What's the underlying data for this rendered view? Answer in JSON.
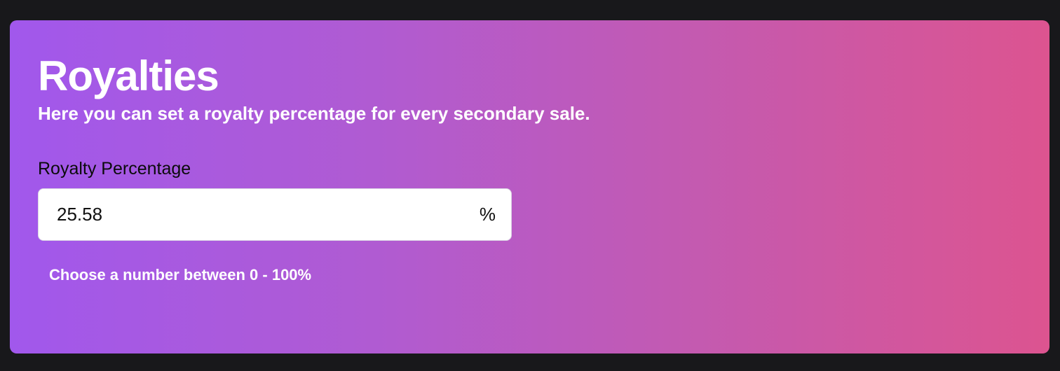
{
  "royalties": {
    "title": "Royalties",
    "subtitle": "Here you can set a royalty percentage for every secondary sale.",
    "field_label": "Royalty Percentage",
    "input_value": "25.58",
    "unit": "%",
    "hint": "Choose a number between 0 - 100%"
  },
  "colors": {
    "page_background": "#18181b",
    "gradient_start": "#a158ec",
    "gradient_end": "#dc5490",
    "input_background": "#ffffff"
  }
}
